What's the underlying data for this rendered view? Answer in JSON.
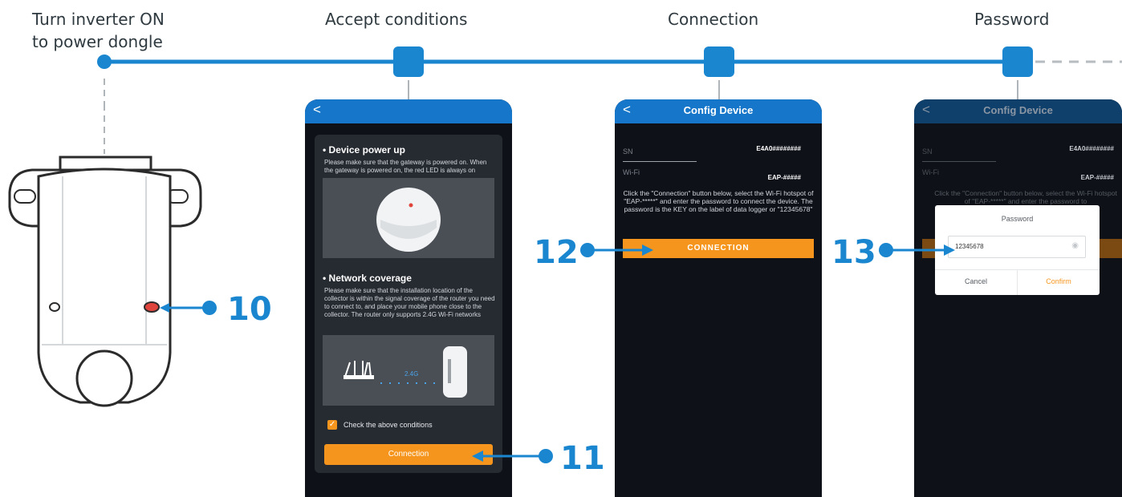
{
  "steps": [
    {
      "title_line1": "Turn inverter ON",
      "title_line2": "to power dongle"
    },
    {
      "title": "Accept conditions"
    },
    {
      "title": "Connection"
    },
    {
      "title": "Password"
    }
  ],
  "callouts": [
    "10",
    "11",
    "12",
    "13"
  ],
  "phone1": {
    "back": "<",
    "section1_title": "• Device power up",
    "section1_text": "Please make sure that the gateway is powered on. When the gateway is powered on, the red LED is always on",
    "section2_title": "• Network coverage",
    "section2_text": "Please make sure that the installation location of the collector is within the signal coverage of the router you need to connect to, and place your mobile phone close to the collector. The router only supports 2.4G Wi-Fi networks",
    "band_label": "2.4G",
    "checkbox_label": "Check the above conditions",
    "checkbox_checked": true,
    "button_label": "Connection"
  },
  "phone2": {
    "back": "<",
    "title": "Config Device",
    "sn_label": "SN",
    "sn_value": "E4A0########",
    "wifi_label": "Wi-Fi",
    "wifi_value": "EAP-#####",
    "instructions": "Click the \"Connection\" button below, select the Wi-Fi hotspot of \"EAP-*****\" and enter the password to connect the device. The password is the KEY on the label of data logger or \"12345678\"",
    "button_label": "CONNECTION"
  },
  "phone3": {
    "back": "<",
    "title": "Config Device",
    "sn_label": "SN",
    "sn_value": "E4A0########",
    "wifi_label": "Wi-Fi",
    "wifi_value": "EAP-#####",
    "instructions": "Click the \"Connection\" button below, select the Wi-Fi hotspot of \"EAP-*****\" and enter the password to",
    "dialog": {
      "title": "Password",
      "value": "12345678",
      "cancel": "Cancel",
      "confirm": "Confirm"
    }
  },
  "colors": {
    "accent_blue": "#1a86cf",
    "app_bar": "#1676c9",
    "orange": "#f5951d",
    "phone_bg": "#0e1118"
  }
}
